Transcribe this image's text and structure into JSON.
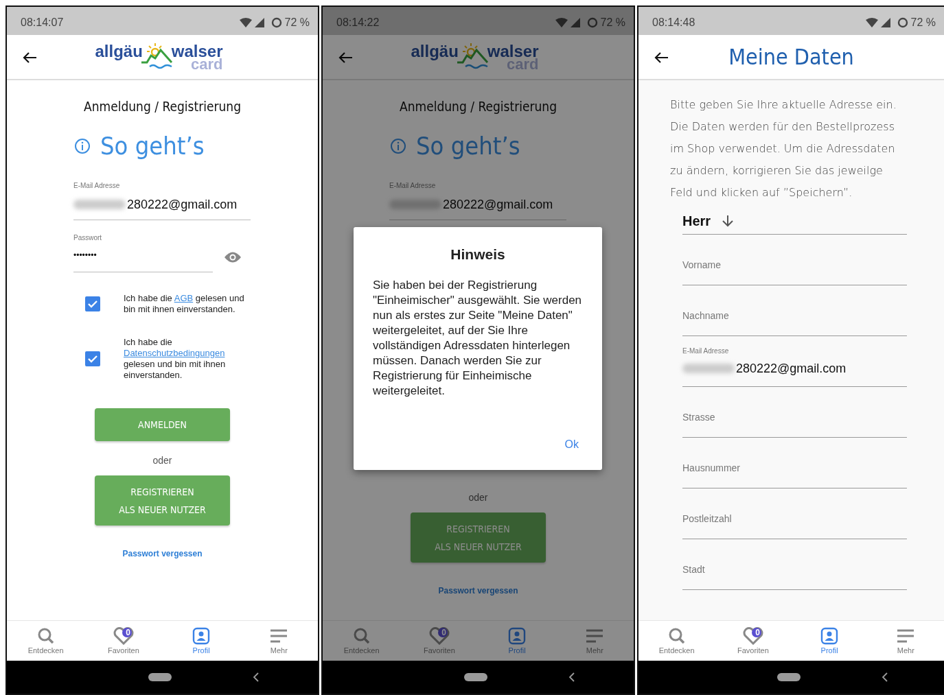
{
  "screens": [
    {
      "kind": "login",
      "status_bar": {
        "time": "08:14:07",
        "battery": "72 %"
      },
      "header": {
        "logo": {
          "word_1": "allgäu",
          "word_2": "walser",
          "word_3": "card"
        }
      },
      "heading": "Anmeldung / Registrierung",
      "info_title": "So geht’s",
      "email_field": {
        "label": "E-Mail Adresse",
        "value": "280222@gmail.com"
      },
      "password_field": {
        "label": "Passwort",
        "value": "••••••••"
      },
      "consents": [
        {
          "checked": true,
          "before": "Ich habe die ",
          "link": "AGB",
          "after": " gelesen und bin mit ihnen einverstanden."
        },
        {
          "checked": true,
          "before": "Ich habe die ",
          "link": "Datenschutzbedingungen",
          "after": " gelesen und bin mit ihnen einverstanden."
        }
      ],
      "login_button": "ANMELDEN",
      "separator": "oder",
      "register_button": [
        "REGISTRIEREN",
        "ALS NEUER NUTZER"
      ],
      "forgot_link": "Passwort vergessen",
      "nav": [
        {
          "label": "Entdecken",
          "kind": "search",
          "selected": false
        },
        {
          "label": "Favoriten",
          "kind": "heart",
          "selected": false,
          "badge": "0"
        },
        {
          "label": "Profil",
          "kind": "profile",
          "selected": true
        },
        {
          "label": "Mehr",
          "kind": "menu",
          "selected": false
        }
      ]
    },
    {
      "kind": "login",
      "status_bar": {
        "time": "08:14:22",
        "battery": "72 %"
      },
      "header": {
        "logo": {
          "word_1": "allgäu",
          "word_2": "walser",
          "word_3": "card"
        }
      },
      "heading": "Anmeldung / Registrierung",
      "info_title": "So geht’s",
      "email_field": {
        "label": "E-Mail Adresse",
        "value": "280222@gmail.com"
      },
      "separator": "oder",
      "register_button": [
        "REGISTRIEREN",
        "ALS NEUER NUTZER"
      ],
      "forgot_link": "Passwort vergessen",
      "nav": [
        {
          "label": "Entdecken",
          "kind": "search",
          "selected": false
        },
        {
          "label": "Favoriten",
          "kind": "heart",
          "selected": false,
          "badge": "0"
        },
        {
          "label": "Profil",
          "kind": "profile",
          "selected": true
        },
        {
          "label": "Mehr",
          "kind": "menu",
          "selected": false
        }
      ],
      "dialog": {
        "title": "Hinweis",
        "text": "Sie haben bei der Registrierung \"Einheimischer\" ausgewählt. Sie werden nun als erstes zur Seite \"Meine Daten\" weitergeleitet, auf der Sie Ihre vollständigen Adressdaten hinterlegen müssen. Danach werden Sie zur Registrierung für Einheimische weitergeleitet.",
        "button": "Ok"
      }
    },
    {
      "kind": "profile_form",
      "status_bar": {
        "time": "08:14:48",
        "battery": "72 %"
      },
      "header": {
        "title": "Meine Daten"
      },
      "intro": "Bitte geben Sie Ihre aktuelle Adresse ein. Die Daten werden für den Bestellprozess im Shop verwendet. Um die Adressdaten zu ändern, korrigieren Sie das jeweilge Feld und klicken auf ”Speichern”.",
      "salutation_select": {
        "value": "Herr"
      },
      "fields": [
        {
          "kind": "empty",
          "placeholder": "Vorname"
        },
        {
          "kind": "empty",
          "placeholder": "Nachname"
        },
        {
          "kind": "filled",
          "label": "E-Mail Adresse",
          "value": "280222@gmail.com"
        },
        {
          "kind": "empty",
          "placeholder": "Strasse"
        },
        {
          "kind": "empty",
          "placeholder": "Hausnummer"
        },
        {
          "kind": "empty",
          "placeholder": "Postleitzahl"
        },
        {
          "kind": "empty",
          "placeholder": "Stadt"
        }
      ],
      "nav": [
        {
          "label": "Entdecken",
          "kind": "search",
          "selected": false
        },
        {
          "label": "Favoriten",
          "kind": "heart",
          "selected": false,
          "badge": "0"
        },
        {
          "label": "Profil",
          "kind": "profile",
          "selected": true
        },
        {
          "label": "Mehr",
          "kind": "menu",
          "selected": false
        }
      ]
    }
  ]
}
